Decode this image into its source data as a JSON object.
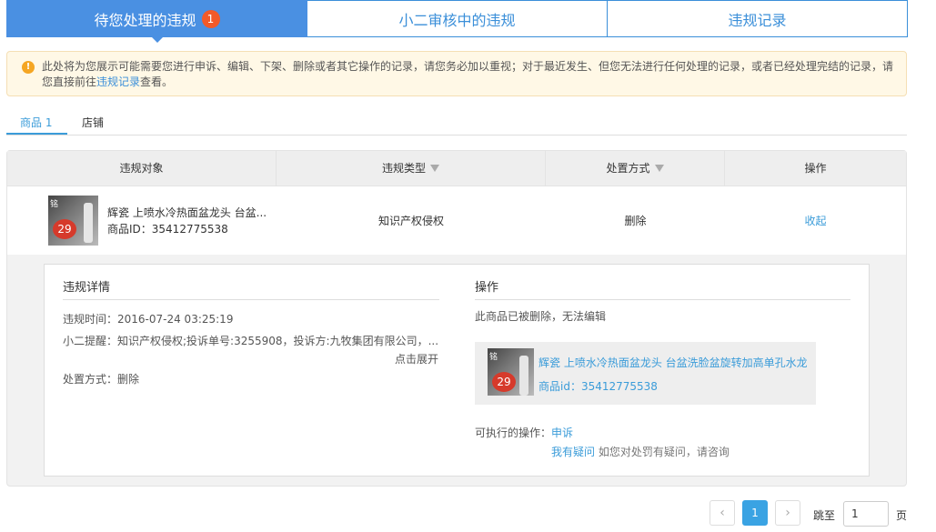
{
  "top_tabs": [
    {
      "label": "待您处理的违规",
      "badge": "1"
    },
    {
      "label": "小二审核中的违规"
    },
    {
      "label": "违规记录"
    }
  ],
  "notice": {
    "text_before": "此处将为您展示可能需要您进行申诉、编辑、下架、删除或者其它操作的记录，请您务必加以重视；对于最近发生、但您无法进行任何处理的记录，或者已经处理完结的记录，请您直接前往",
    "link": "违规记录",
    "text_after": "查看。"
  },
  "sub_tabs": [
    {
      "label": "商品 1"
    },
    {
      "label": "店铺"
    }
  ],
  "table": {
    "headers": [
      "违规对象",
      "违规类型",
      "处置方式",
      "操作"
    ],
    "row": {
      "goods_title": "辉瓷 上喷水冷热面盆龙头 台盆...",
      "goods_id": "商品ID：35412775538",
      "violation_type": "知识产权侵权",
      "disposal": "删除",
      "action": "收起"
    }
  },
  "thumb": {
    "brand": "铭",
    "price": "29"
  },
  "detail": {
    "left_title": "违规详情",
    "time": "违规时间：2016-07-24 03:25:19",
    "reminder": "小二提醒：知识产权侵权;投诉单号:3255908，投诉方:九牧集团有限公司，...",
    "expand": "点击展开",
    "disposal": "处置方式：删除",
    "right_title": "操作",
    "deleted_note": "此商品已被删除，无法编辑",
    "goods_full_title": "辉瓷 上喷水冷热面盆龙头 台盆洗脸盆旋转加高单孔水龙头",
    "goods_id": "商品id：35412775538",
    "exec_label": "可执行的操作：",
    "appeal": "申诉",
    "question_link": "我有疑问",
    "question_hint": "如您对处罚有疑问，请咨询"
  },
  "pagination": {
    "prev": "‹",
    "current": "1",
    "next": "›",
    "jump_label": "跳至",
    "jump_value": "1",
    "page_label": "页"
  },
  "colors": {
    "primary": "#4a90e2",
    "link": "#3b9cd9",
    "badge": "#f25a29",
    "warn": "#f5a623"
  }
}
